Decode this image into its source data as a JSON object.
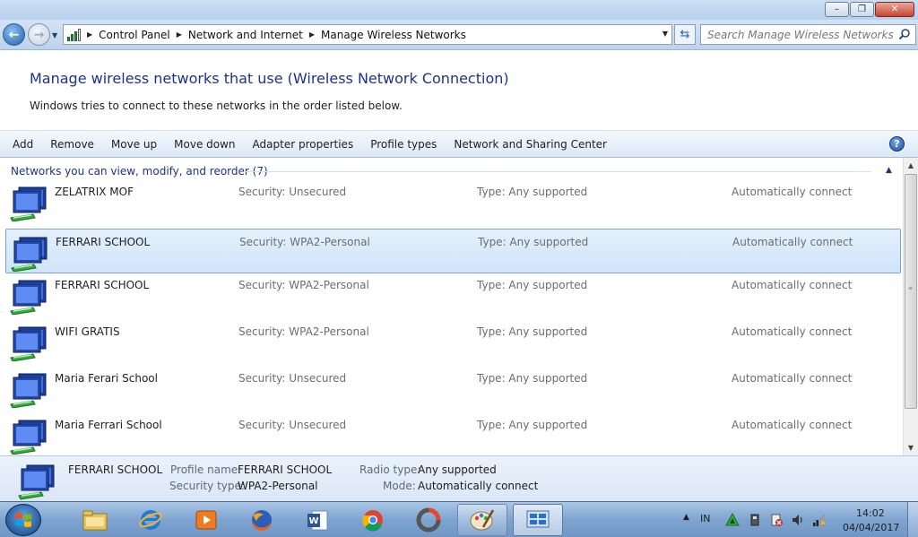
{
  "window": {
    "buttons": {
      "minimize": "–",
      "maximize": "❐",
      "close": "✕"
    }
  },
  "address": {
    "breadcrumbs": [
      "Control Panel",
      "Network and Internet",
      "Manage Wireless Networks"
    ],
    "search_placeholder": "Search Manage Wireless Networks"
  },
  "header": {
    "title": "Manage wireless networks that use (Wireless Network Connection)",
    "subtitle": "Windows tries to connect to these networks in the order listed below."
  },
  "toolbar": {
    "items": [
      "Add",
      "Remove",
      "Move up",
      "Move down",
      "Adapter properties",
      "Profile types",
      "Network and Sharing Center"
    ]
  },
  "list": {
    "group_header": "Networks you can view, modify, and reorder (7)",
    "networks": [
      {
        "name": "ZELATRIX MOF",
        "security": "Security:  Unsecured",
        "type": "Type:  Any supported",
        "mode": "Automatically connect",
        "selected": false
      },
      {
        "name": "FERRARI SCHOOL",
        "security": "Security:  WPA2-Personal",
        "type": "Type:  Any supported",
        "mode": "Automatically connect",
        "selected": true
      },
      {
        "name": "FERRARI SCHOOL",
        "security": "Security:  WPA2-Personal",
        "type": "Type:  Any supported",
        "mode": "Automatically connect",
        "selected": false
      },
      {
        "name": "WIFI GRATIS",
        "security": "Security:  WPA2-Personal",
        "type": "Type:  Any supported",
        "mode": "Automatically connect",
        "selected": false
      },
      {
        "name": "Maria Ferari School",
        "security": "Security:  Unsecured",
        "type": "Type:  Any supported",
        "mode": "Automatically connect",
        "selected": false
      },
      {
        "name": "Maria Ferrari School",
        "security": "Security:  Unsecured",
        "type": "Type:  Any supported",
        "mode": "Automatically connect",
        "selected": false
      }
    ]
  },
  "details": {
    "name": "FERRARI SCHOOL",
    "profile_name_label": "Profile name:",
    "profile_name": "FERRARI SCHOOL",
    "security_type_label": "Security type:",
    "security_type": "WPA2-Personal",
    "radio_type_label": "Radio type:",
    "radio_type": "Any supported",
    "mode_label": "Mode:",
    "mode": "Automatically connect"
  },
  "taskbar": {
    "apps": [
      "windows-explorer",
      "internet-explorer",
      "media-player",
      "firefox",
      "word",
      "chrome",
      "app-ring",
      "paint",
      "control-panel"
    ],
    "language": "IN",
    "time": "14:02",
    "date": "04/04/2017"
  },
  "colors": {
    "heading_blue": "#1e3287",
    "selection_bg": "#cfe4fa",
    "selection_border": "#7da2ce"
  }
}
